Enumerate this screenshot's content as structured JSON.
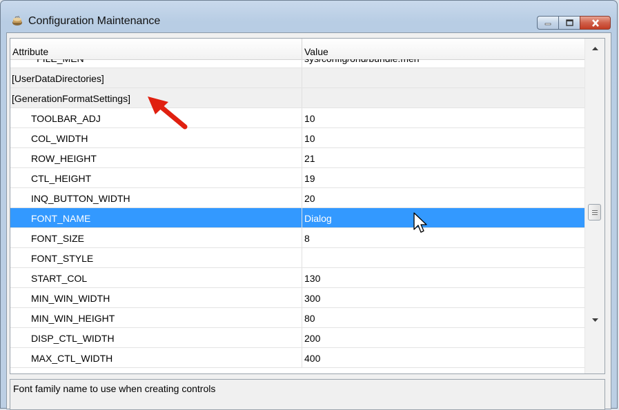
{
  "window": {
    "title": "Configuration Maintenance",
    "minimize_label": "Minimize",
    "maximize_label": "Maximize",
    "close_label": "Close"
  },
  "grid": {
    "headers": {
      "attribute": "Attribute",
      "value": "Value"
    },
    "rows": [
      {
        "attr": "~FILE_MEN",
        "value": "sys/config/ohd/bundle.men",
        "kind": "partial"
      },
      {
        "attr": "[UserDataDirectories]",
        "value": "",
        "kind": "section"
      },
      {
        "attr": "[GenerationFormatSettings]",
        "value": "",
        "kind": "section"
      },
      {
        "attr": "TOOLBAR_ADJ",
        "value": "10",
        "kind": "item"
      },
      {
        "attr": "COL_WIDTH",
        "value": "10",
        "kind": "item"
      },
      {
        "attr": "ROW_HEIGHT",
        "value": "21",
        "kind": "item"
      },
      {
        "attr": "CTL_HEIGHT",
        "value": "19",
        "kind": "item"
      },
      {
        "attr": "INQ_BUTTON_WIDTH",
        "value": "20",
        "kind": "item"
      },
      {
        "attr": "FONT_NAME",
        "value": "Dialog",
        "kind": "selected"
      },
      {
        "attr": "FONT_SIZE",
        "value": "8",
        "kind": "item"
      },
      {
        "attr": "FONT_STYLE",
        "value": "",
        "kind": "item"
      },
      {
        "attr": "START_COL",
        "value": "130",
        "kind": "item"
      },
      {
        "attr": "MIN_WIN_WIDTH",
        "value": "300",
        "kind": "item"
      },
      {
        "attr": "MIN_WIN_HEIGHT",
        "value": "80",
        "kind": "item"
      },
      {
        "attr": "DISP_CTL_WIDTH",
        "value": "200",
        "kind": "item"
      },
      {
        "attr": "MAX_CTL_WIDTH",
        "value": "400",
        "kind": "partial"
      }
    ]
  },
  "description": "Font family name to use when creating controls",
  "colors": {
    "selection": "#3399ff",
    "arrow": "#e02010"
  },
  "icons": [
    "app-icon",
    "minimize-icon",
    "maximize-icon",
    "close-icon",
    "scroll-up-icon",
    "scroll-down-icon",
    "red-arrow-icon",
    "mouse-cursor-icon"
  ]
}
